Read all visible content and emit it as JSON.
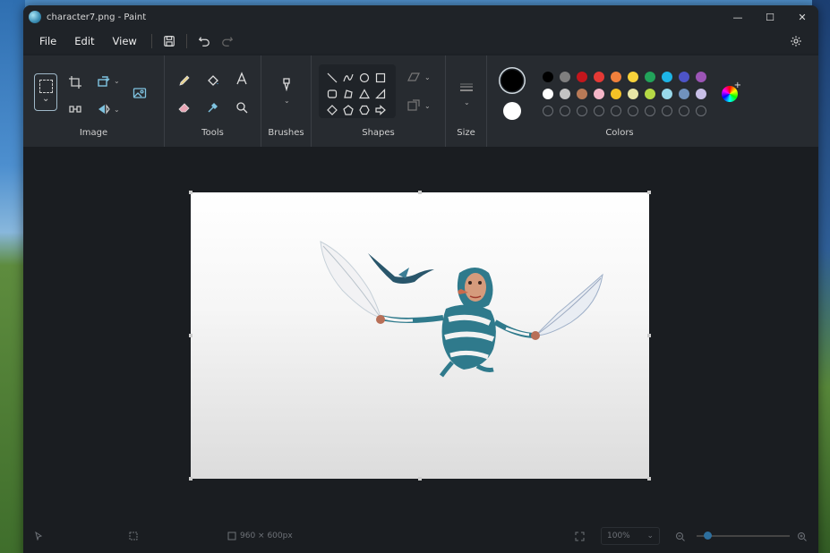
{
  "window": {
    "title": "character7.png - Paint",
    "controls": {
      "minimize": "—",
      "maximize": "☐",
      "close": "✕"
    }
  },
  "menu": {
    "items": [
      "File",
      "Edit",
      "View"
    ],
    "icons": [
      "save-icon",
      "undo-icon",
      "redo-icon",
      "settings-icon"
    ]
  },
  "ribbon": {
    "groups": {
      "image": "Image",
      "tools": "Tools",
      "brushes": "Brushes",
      "shapes": "Shapes",
      "size": "Size",
      "colors": "Colors"
    },
    "primary_color": "#000000",
    "secondary_color": "#ffffff",
    "palette_row1": [
      "#000000",
      "#7f7f7f",
      "#c4161c",
      "#e53935",
      "#f0803c",
      "#f7d23a",
      "#22a35a",
      "#1db4e6",
      "#4d54c8",
      "#9c55b6"
    ],
    "palette_row2": [
      "#ffffff",
      "#c3c3c3",
      "#b97a57",
      "#f4b6c8",
      "#f5c326",
      "#e7e5a6",
      "#b5d945",
      "#99d9ea",
      "#7092be",
      "#c8bfe7"
    ]
  },
  "status": {
    "canvas_size": "960 × 600px",
    "zoom": "100%"
  }
}
